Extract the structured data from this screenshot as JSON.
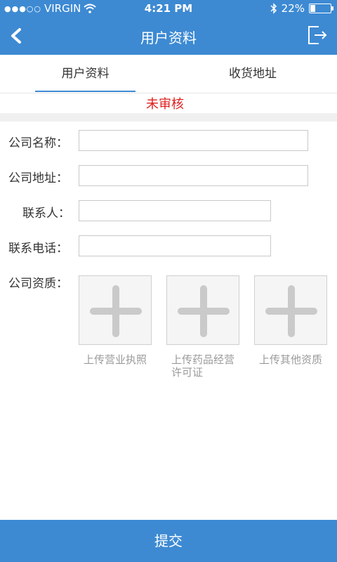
{
  "status_bar": {
    "signal": "●●●○○",
    "carrier": "VIRGIN",
    "time": "4:21 PM",
    "battery": "22%",
    "battery_level": 0.22
  },
  "header": {
    "title": "用户资料"
  },
  "tabs": [
    {
      "label": "用户资料",
      "active": true
    },
    {
      "label": "收货地址",
      "active": false
    }
  ],
  "review_status": "未审核",
  "form": {
    "company_name_label": "公司名称：",
    "company_address_label": "公司地址：",
    "contact_label": "联系人：",
    "phone_label": "联系电话：",
    "qualification_label": "公司资质："
  },
  "uploads": [
    {
      "caption_line1": "上传营业执照",
      "caption_line2": ""
    },
    {
      "caption_line1": "上传药品经营",
      "caption_line2": "许可证"
    },
    {
      "caption_line1": "上传其他资质",
      "caption_line2": ""
    }
  ],
  "submit_label": "提交",
  "colors": {
    "primary": "#3d8ad3",
    "status_red": "#e02020"
  }
}
